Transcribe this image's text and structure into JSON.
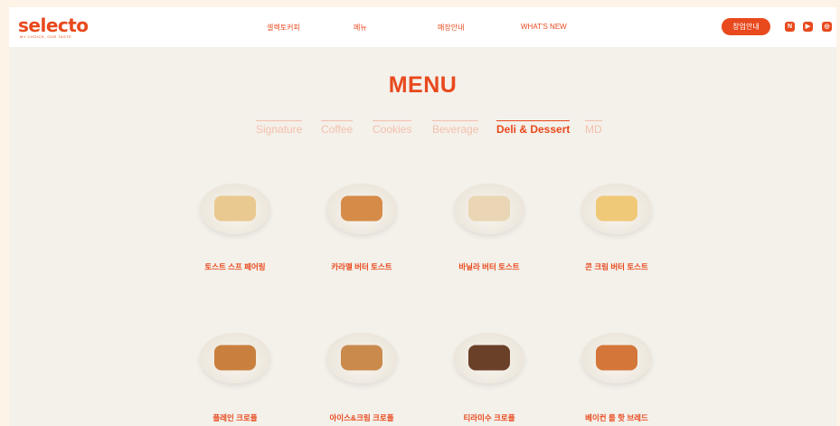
{
  "header": {
    "logo": "selecto",
    "logo_sub": "MY CHOICE, OUR TASTE",
    "nav": [
      "셀렉토커피",
      "메뉴",
      "매장안내",
      "WHAT'S NEW"
    ],
    "cta": "창업안내",
    "sns": [
      {
        "icon": "naver-blog-icon",
        "glyph": "N"
      },
      {
        "icon": "youtube-icon",
        "glyph": "▶"
      },
      {
        "icon": "instagram-icon",
        "glyph": "◎"
      }
    ]
  },
  "page": {
    "title": "MENU"
  },
  "tabs": [
    {
      "label": "Signature",
      "active": false
    },
    {
      "label": "Coffee",
      "active": false
    },
    {
      "label": "Cookies",
      "active": false
    },
    {
      "label": "Beverage",
      "active": false
    },
    {
      "label": "Deli & Dessert",
      "active": true
    },
    {
      "label": "MD",
      "active": false
    }
  ],
  "items": [
    {
      "name": "토스트 스프 페어링",
      "food_color": "#e9c98f"
    },
    {
      "name": "카라멜 버터 토스트",
      "food_color": "#d68b49"
    },
    {
      "name": "바닐라 버터 토스트",
      "food_color": "#ead6b4"
    },
    {
      "name": "콘 크림 버터 토스트",
      "food_color": "#f0c978"
    },
    {
      "name": "플레인 크로플",
      "food_color": "#c9803f"
    },
    {
      "name": "아이스&크림 크로플",
      "food_color": "#c98a4c"
    },
    {
      "name": "티라미수 크로플",
      "food_color": "#6b4029"
    },
    {
      "name": "베이컨 롤 핫 브레드",
      "food_color": "#d4763a"
    }
  ],
  "colors": {
    "accent": "#e8491d",
    "background": "#f4f0ea",
    "tab_inactive": "#f4c0ad"
  }
}
